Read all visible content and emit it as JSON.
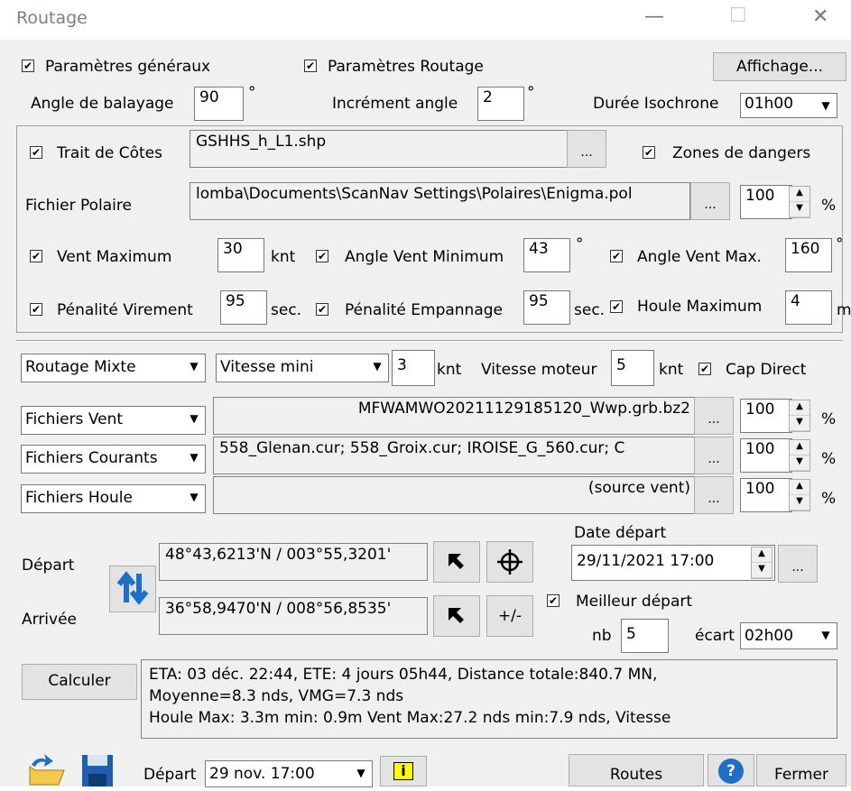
{
  "window": {
    "title": "Routage",
    "minimize": "—",
    "maximize": "☐",
    "close": "✕"
  },
  "top": {
    "general_params": "Paramètres généraux",
    "routing_params": "Paramètres Routage",
    "display_button": "Affichage..."
  },
  "sweep": {
    "angle_label": "Angle de balayage",
    "angle_value": "90",
    "angle_unit": "°",
    "increment_label": "Incrément angle",
    "increment_value": "2",
    "increment_unit": "°",
    "isochrone_label": "Durée Isochrone",
    "isochrone_value": "01h00"
  },
  "coast": {
    "label": "Trait de Côtes",
    "file": "GSHHS_h_L1.shp",
    "browse": "...",
    "danger_zones": "Zones de dangers"
  },
  "polar": {
    "label": "Fichier Polaire",
    "file": "lomba\\Documents\\ScanNav Settings\\Polaires\\Enigma.pol",
    "browse": "...",
    "percent": "100",
    "unit": "%"
  },
  "wind": {
    "max_label": "Vent Maximum",
    "max_value": "30",
    "max_unit": "knt",
    "min_angle_label": "Angle Vent Minimum",
    "min_angle_value": "43",
    "min_angle_unit": "°",
    "max_angle_label": "Angle Vent Max.",
    "max_angle_value": "160",
    "max_angle_unit": "°"
  },
  "penalty": {
    "tack_label": "Pénalité Virement",
    "tack_value": "95",
    "tack_unit": "sec.",
    "gybe_label": "Pénalité Empannage",
    "gybe_value": "95",
    "gybe_unit": "sec.",
    "swell_label": "Houle Maximum",
    "swell_value": "4",
    "swell_unit": "m"
  },
  "mode": {
    "routing_type": "Routage Mixte",
    "speed_type": "Vitesse mini",
    "speed_value": "3",
    "speed_unit": "knt",
    "motor_label": "Vitesse moteur",
    "motor_value": "5",
    "motor_unit": "knt",
    "direct_label": "Cap Direct"
  },
  "files": [
    {
      "type": "Fichiers Vent",
      "value": "MFWAMWO20211129185120_Wwp.grb.bz2",
      "browse": "...",
      "percent": "100",
      "unit": "%"
    },
    {
      "type": "Fichiers Courants",
      "value": "558_Glenan.cur; 558_Groix.cur; IROISE_G_560.cur; C",
      "browse": "...",
      "percent": "100",
      "unit": "%"
    },
    {
      "type": "Fichiers Houle",
      "value": "(source vent)",
      "browse": "...",
      "percent": "100",
      "unit": "%"
    }
  ],
  "route": {
    "departure_label": "Départ",
    "departure_value": "48°43,6213'N / 003°55,3201'",
    "arrival_label": "Arrivée",
    "arrival_value": "36°58,9470'N / 008°56,8535'",
    "plusminus": "+/-",
    "date_label": "Date départ",
    "date_value": "29/11/2021 17:00",
    "date_browse": "...",
    "best_departure": "Meilleur départ",
    "nb_label": "nb",
    "nb_value": "5",
    "gap_label": "écart",
    "gap_value": "02h00"
  },
  "result": {
    "compute_button": "Calculer",
    "line1": "ETA: 03 déc. 22:44, ETE: 4 jours 05h44, Distance totale:840.7 MN,",
    "line2": "Moyenne=8.3 nds, VMG=7.3 nds",
    "line3": "Houle Max: 3.3m min: 0.9m Vent Max:27.2 nds min:7.9 nds, Vitesse"
  },
  "bottom": {
    "departure_label": "Départ",
    "departure_value": "29 nov. 17:00",
    "info": "i",
    "routes_button": "Routes",
    "close_button": "Fermer",
    "help": "?"
  },
  "colors": {
    "accent_blue": "#1e6fc9",
    "info_yellow": "#ffff00"
  }
}
